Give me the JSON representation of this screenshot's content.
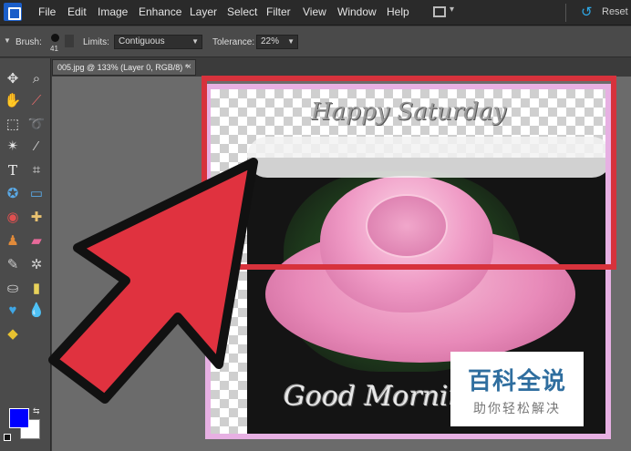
{
  "menubar": {
    "items": [
      "File",
      "Edit",
      "Image",
      "Enhance",
      "Layer",
      "Select",
      "Filter",
      "View",
      "Window",
      "Help"
    ],
    "reset_label": "Reset"
  },
  "options": {
    "brush_label": "Brush:",
    "brush_size": "41",
    "limits_label": "Limits:",
    "limits_value": "Contiguous",
    "tolerance_label": "Tolerance:",
    "tolerance_value": "22%"
  },
  "document": {
    "tab_title": "005.jpg @ 133% (Layer 0, RGB/8) *",
    "close_glyph": "×"
  },
  "image_text": {
    "top": "Happy Saturday",
    "bottom": "Good Morning"
  },
  "colors": {
    "foreground": "#0000ff",
    "background": "#ffffff",
    "highlight": "#d7323c",
    "arrow": "#e0323f"
  },
  "tools": [
    "move-tool-icon",
    "zoom-tool-icon",
    "hand-tool-icon",
    "eyedropper-tool-icon",
    "marquee-tool-icon",
    "lasso-tool-icon",
    "magic-wand-tool-icon",
    "quick-selection-tool-icon",
    "type-tool-icon",
    "crop-tool-icon",
    "cookie-cutter-tool-icon",
    "straighten-tool-icon",
    "red-eye-tool-icon",
    "healing-brush-tool-icon",
    "clone-stamp-tool-icon",
    "eraser-tool-icon",
    "brush-tool-icon",
    "smart-brush-tool-icon",
    "paint-bucket-tool-icon",
    "gradient-tool-icon",
    "shape-tool-icon",
    "blur-tool-icon",
    "sponge-tool-icon"
  ],
  "watermark": {
    "title": "百科全说",
    "subtitle": "助你轻松解决"
  }
}
